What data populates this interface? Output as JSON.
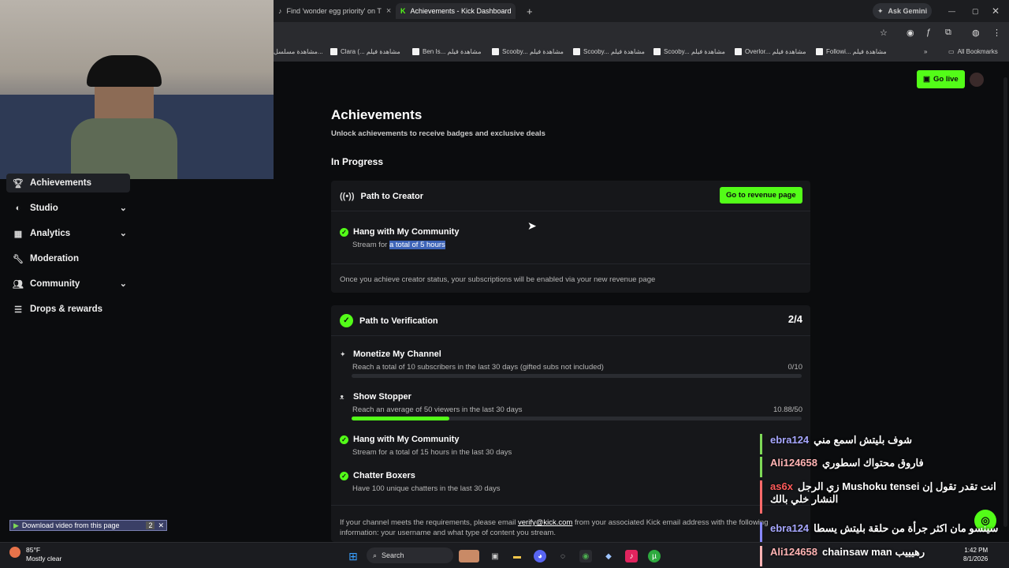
{
  "browser": {
    "tabs": [
      {
        "label": "Find 'wonder egg priority' on T",
        "active": false
      },
      {
        "label": "Achievements - Kick Dashboard",
        "active": true
      }
    ],
    "new_tab": "+",
    "ask_gemini": "Ask Gemini",
    "bookmarks": [
      "مشاهدة مسلسل...",
      "Clara (... مشاهدة فيلم",
      "Ben Is... مشاهدة فيلم",
      "Scooby... مشاهدة فيلم",
      "Scooby... مشاهدة فيلم",
      "Scooby... مشاهدة فيلم",
      "Overlor... مشاهدة فيلم",
      "Followi... مشاهدة فيلم"
    ],
    "all_bookmarks": "All Bookmarks"
  },
  "header": {
    "go_live": "Go live"
  },
  "sidebar": {
    "items": [
      {
        "label": "Achievements",
        "icon": "trophy-icon",
        "selected": true,
        "expandable": false
      },
      {
        "label": "Studio",
        "icon": "studio-icon",
        "selected": false,
        "expandable": true
      },
      {
        "label": "Analytics",
        "icon": "analytics-icon",
        "selected": false,
        "expandable": true
      },
      {
        "label": "Moderation",
        "icon": "wrench-icon",
        "selected": false,
        "expandable": false
      },
      {
        "label": "Community",
        "icon": "users-icon",
        "selected": false,
        "expandable": true
      },
      {
        "label": "Drops & rewards",
        "icon": "drops-icon",
        "selected": false,
        "expandable": false
      }
    ]
  },
  "page": {
    "title": "Achievements",
    "subtitle": "Unlock achievements to receive badges and exclusive deals",
    "section": "In Progress"
  },
  "creator": {
    "title": "Path to Creator",
    "button": "Go to revenue page",
    "item_title": "Hang with My Community",
    "item_desc_prefix": "Stream for ",
    "item_desc_highlight": "a total of 5 hours",
    "note": "Once you achieve creator status, your subscriptions will be enabled via your new revenue page"
  },
  "verification": {
    "title": "Path to Verification",
    "count": "2/4",
    "items": [
      {
        "title": "Monetize My Channel",
        "desc": "Reach a total of 10 subscribers in the last 30 days (gifted subs not included)",
        "progress_text": "0/10",
        "progress": 0.0
      },
      {
        "title": "Show Stopper",
        "desc": "Reach an average of 50 viewers in the last 30 days",
        "progress_text": "10.88/50",
        "progress": 0.2176
      },
      {
        "title": "Hang with My Community",
        "desc": "Stream for a total of 15 hours in the last 30 days"
      },
      {
        "title": "Chatter Boxers",
        "desc": "Have 100 unique chatters in the last 30 days"
      }
    ],
    "footer_prefix": "If your channel meets the requirements, please email ",
    "footer_email": "verify@kick.com",
    "footer_suffix": " from your associated Kick email address with the following",
    "footer_line2": "information: your username and what type of content you stream."
  },
  "download_bar": {
    "label": "Download video from this page",
    "count": "2"
  },
  "chat": [
    {
      "user": "ebra124",
      "color": "#a7a7ff",
      "msg": "شوف بليتش اسمع مني"
    },
    {
      "user": "Ali124658",
      "color": "#ffb3b3",
      "msg": "فاروق محتواك اسطوري"
    },
    {
      "user": "as6x",
      "color": "#ff5a5a",
      "msg": "زي الرجل Mushoku tensei انت تقدر تقول إن"
    },
    {
      "user": "",
      "color": "#ffffff",
      "msg": "النشار خلي بالك"
    },
    {
      "user": "ebra124",
      "color": "#a7a7ff",
      "msg": "سينسو مان اكثر جرأة من حلقة بليتش يسطا"
    },
    {
      "user": "Ali124658",
      "color": "#ffb3b3",
      "msg": "chainsaw man رهيييب"
    }
  ],
  "taskbar": {
    "weather_temp": "85°F",
    "weather_desc": "Mostly clear",
    "search": "Search",
    "time": "1:42 PM",
    "date": "8/1/2026"
  },
  "colors": {
    "kick_green": "#53fc18",
    "background": "#0b0c0e",
    "card": "#16171a"
  }
}
